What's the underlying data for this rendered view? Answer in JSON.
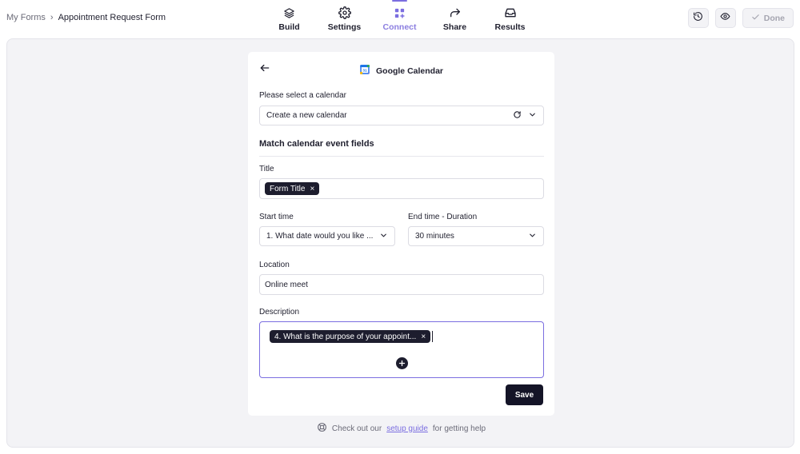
{
  "breadcrumb": {
    "root": "My Forms",
    "separator": "›",
    "current": "Appointment Request Form"
  },
  "nav": {
    "items": [
      {
        "label": "Build",
        "icon": "layers-icon",
        "active": false
      },
      {
        "label": "Settings",
        "icon": "gear-icon",
        "active": false
      },
      {
        "label": "Connect",
        "icon": "apps-plus-icon",
        "active": true
      },
      {
        "label": "Share",
        "icon": "share-arrow-icon",
        "active": false
      },
      {
        "label": "Results",
        "icon": "inbox-icon",
        "active": false
      }
    ]
  },
  "actions": {
    "history_icon": "history-icon",
    "preview_icon": "eye-icon",
    "done_label": "Done"
  },
  "panel": {
    "title": "Google Calendar",
    "calendar_badge": "31",
    "calendar_label": "Please select a calendar",
    "calendar_value": "Create a new calendar",
    "section_title": "Match calendar event fields",
    "title_label": "Title",
    "title_chip": "Form Title",
    "start_label": "Start time",
    "start_value": "1. What date would you like ...",
    "end_label": "End time - Duration",
    "end_value": "30 minutes",
    "location_label": "Location",
    "location_value": "Online meet",
    "description_label": "Description",
    "description_chip": "4. What is the purpose of your appoint...",
    "chip_remove": "×",
    "save_label": "Save"
  },
  "help": {
    "prefix": "Check out our",
    "link": "setup guide",
    "suffix": "for getting help"
  },
  "colors": {
    "accent": "#7b6ee0",
    "dark": "#141427",
    "workspace_bg": "#f3f3f6"
  }
}
